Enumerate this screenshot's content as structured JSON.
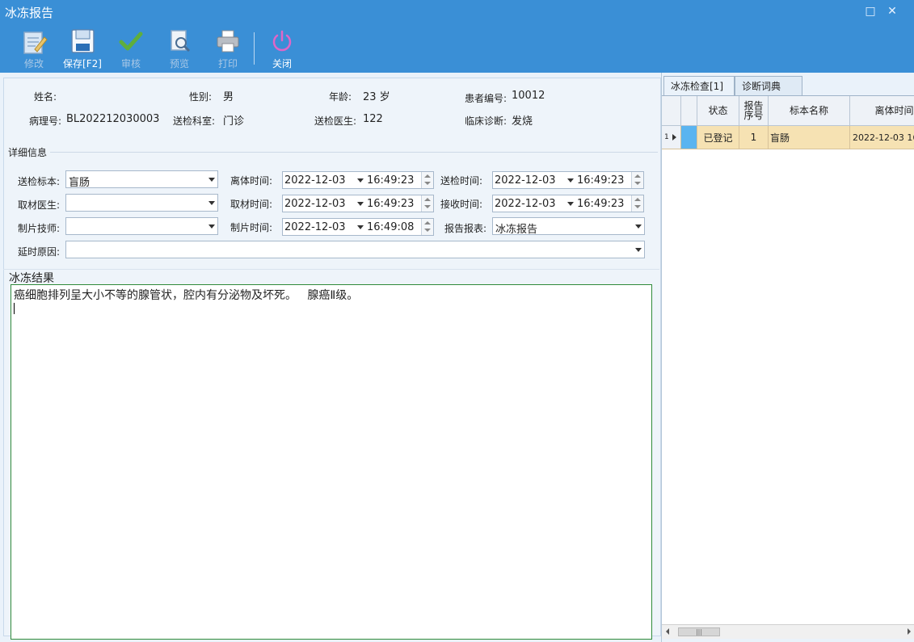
{
  "window": {
    "title": "冰冻报告"
  },
  "toolbar": {
    "edit": "修改",
    "save": "保存[F2]",
    "audit": "审核",
    "preview": "预览",
    "print": "打印",
    "close": "关闭"
  },
  "patient": {
    "name_label": "姓名:",
    "name_value": "",
    "gender_label": "性别:",
    "gender_value": "男",
    "age_label": "年龄:",
    "age_value": "23 岁",
    "patient_no_label": "患者编号:",
    "patient_no_value": "10012",
    "pathology_no_label": "病理号:",
    "pathology_no_value": "BL202212030003",
    "dept_label": "送检科室:",
    "dept_value": "门诊",
    "doctor_label": "送检医生:",
    "doctor_value": "122",
    "diagnosis_label": "临床诊断:",
    "diagnosis_value": "发烧"
  },
  "details": {
    "section_title": "详细信息",
    "specimen_label": "送检标本:",
    "specimen_value": "盲肠",
    "sampling_doctor_label": "取材医生:",
    "sampling_doctor_value": "",
    "technician_label": "制片技师:",
    "technician_value": "",
    "delay_reason_label": "延时原因:",
    "delay_reason_value": "",
    "detach_time_label": "离体时间:",
    "detach_date": "2022-12-03",
    "detach_time": "16:49:23",
    "sampling_time_label": "取材时间:",
    "sampling_date": "2022-12-03",
    "sampling_time": "16:49:23",
    "slide_time_label": "制片时间:",
    "slide_date": "2022-12-03",
    "slide_time": "16:49:08",
    "submit_time_label": "送检时间:",
    "submit_date": "2022-12-03",
    "submit_time": "16:49:23",
    "receive_time_label": "接收时间:",
    "receive_date": "2022-12-03",
    "receive_time": "16:49:23",
    "report_form_label": "报告报表:",
    "report_form_value": "冰冻报告"
  },
  "result": {
    "section_title": "冰冻结果",
    "text": "癌细胞排列呈大小不等的腺管状，腔内有分泌物及坏死。   腺癌Ⅱ级。"
  },
  "right_panel": {
    "tabs": [
      "冰冻检查[1]",
      "诊断词典"
    ],
    "columns": [
      "状态",
      "报告序号",
      "标本名称",
      "离体时间"
    ],
    "rows": [
      {
        "row_no": "1",
        "status": "已登记",
        "report_seq": "1",
        "specimen": "盲肠",
        "detach_time": "2022-12-03 16"
      }
    ]
  }
}
